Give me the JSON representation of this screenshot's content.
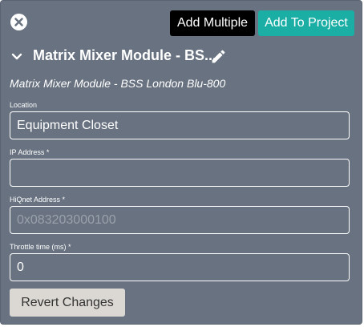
{
  "header": {
    "close_icon": "close-icon",
    "add_multiple_label": "Add Multiple",
    "add_to_project_label": "Add To Project"
  },
  "module": {
    "title": "Matrix Mixer Module - BS...",
    "subtitle": "Matrix Mixer Module - BSS London Blu-800",
    "chevron_icon": "chevron-down-icon",
    "edit_icon": "pencil-icon"
  },
  "fields": {
    "location": {
      "label": "Location",
      "value": "Equipment Closet",
      "placeholder": ""
    },
    "ip_address": {
      "label": "IP Address *",
      "value": "",
      "placeholder": ""
    },
    "hiqnet_address": {
      "label": "HiQnet Address *",
      "value": "",
      "placeholder": "0x083203000100"
    },
    "throttle_time": {
      "label": "Throttle time (ms) *",
      "value": "0",
      "placeholder": ""
    }
  },
  "footer": {
    "revert_label": "Revert Changes"
  },
  "colors": {
    "panel_bg": "#687280",
    "accent_teal": "#1aaea5",
    "button_dark": "#000000",
    "revert_bg": "#dbd8d3"
  }
}
